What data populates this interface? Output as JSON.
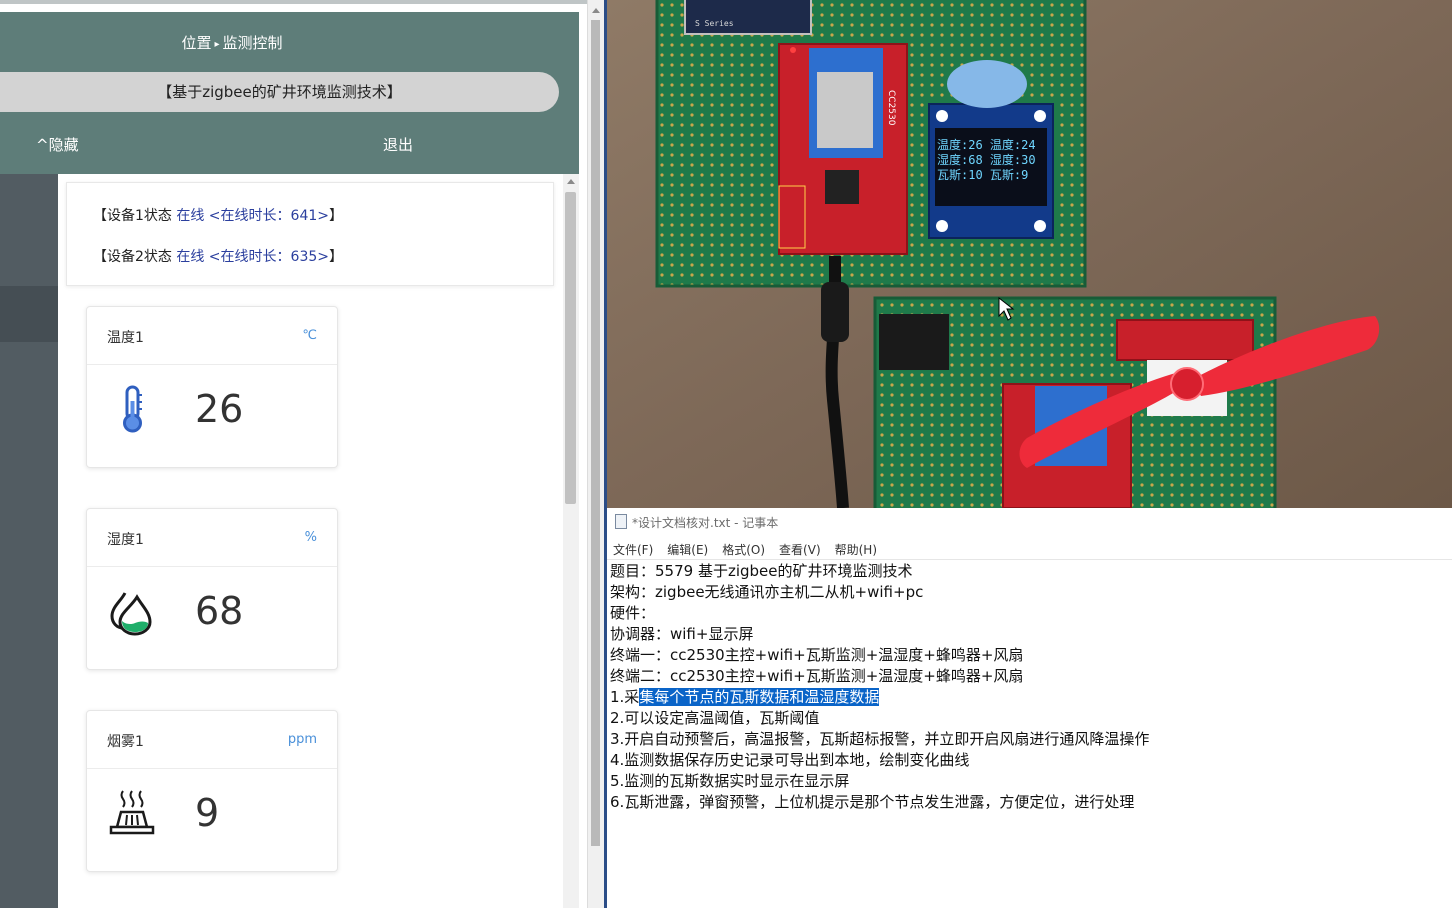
{
  "browser": {
    "breadcrumb": {
      "location": "位置",
      "separator": "▸",
      "page": "监测控制"
    },
    "title": "【基于zigbee的矿井环境监测技术】",
    "hide_label": "^隐藏",
    "exit_label": "退出",
    "status": [
      {
        "prefix": "【设备1状态 ",
        "state": "在线",
        "duration": " <在线时长：641>",
        "suffix": "】"
      },
      {
        "prefix": "【设备2状态 ",
        "state": "在线",
        "duration": " <在线时长：635>",
        "suffix": "】"
      }
    ],
    "cards": [
      {
        "title": "温度1",
        "unit": "℃",
        "value": "26",
        "icon": "thermometer-icon"
      },
      {
        "title": "湿度1",
        "unit": "%",
        "value": "68",
        "icon": "water-drop-icon"
      },
      {
        "title": "烟雾1",
        "unit": "ppm",
        "value": "9",
        "icon": "smoke-icon"
      }
    ]
  },
  "photo": {
    "oled_lines": [
      "温度:26 温度:24",
      "湿度:68 湿度:30",
      "瓦斯:10 瓦斯:9"
    ],
    "module_label": "CC2530",
    "esp_label": "S Series"
  },
  "notepad": {
    "title": "*设计文档核对.txt - 记事本",
    "menu": [
      "文件(F)",
      "编辑(E)",
      "格式(O)",
      "查看(V)",
      "帮助(H)"
    ],
    "lines": [
      "题目：5579 基于zigbee的矿井环境监测技术",
      "架构：zigbee无线通讯亦主机二从机+wifi+pc",
      "硬件：",
      "协调器：wifi+显示屏",
      "终端一：cc2530主控+wifi+瓦斯监测+温湿度+蜂鸣器+风扇",
      "终端二：cc2530主控+wifi+瓦斯监测+温湿度+蜂鸣器+风扇"
    ],
    "line7_before": "1.采",
    "line7_selected": "集每个节点的瓦斯数据和温湿度数据",
    "lines_after": [
      "2.可以设定高温阈值，瓦斯阈值",
      "3.开启自动预警后，高温报警，瓦斯超标报警，并立即开启风扇进行通风降温操作",
      "4.监测数据保存历史记录可导出到本地，绘制变化曲线",
      "5.监测的瓦斯数据实时显示在显示屏",
      "6.瓦斯泄露，弹窗预警，上位机提示是那个节点发生泄露，方便定位，进行处理"
    ]
  }
}
